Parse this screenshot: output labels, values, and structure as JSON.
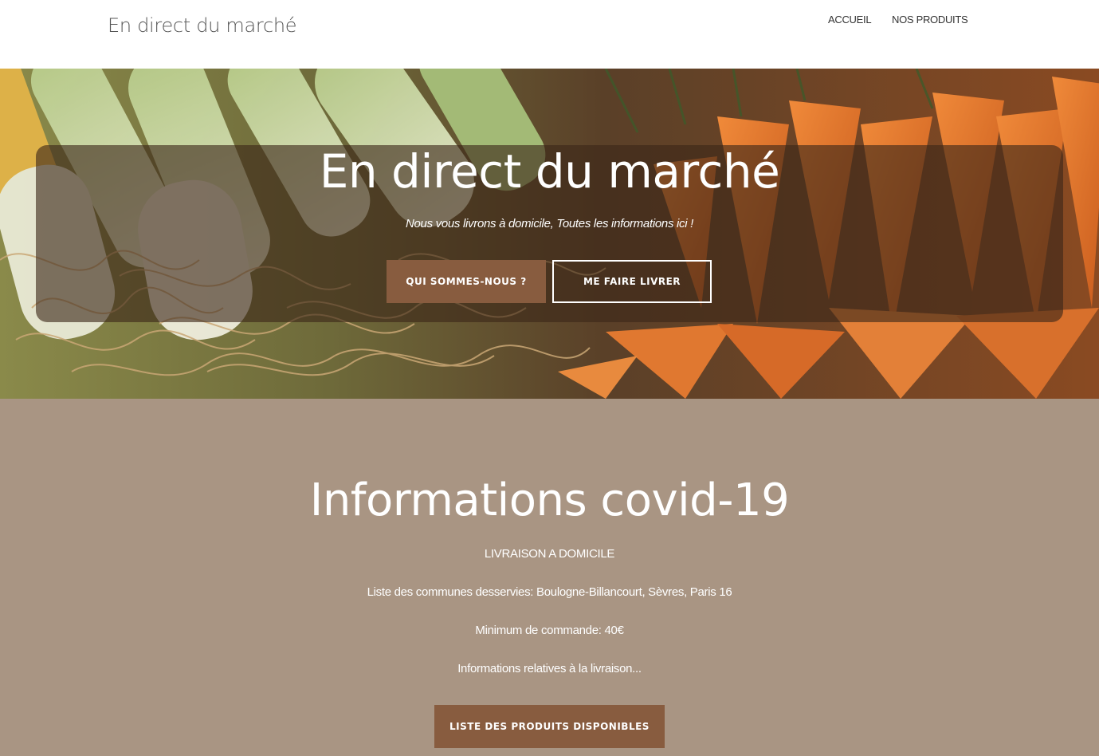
{
  "header": {
    "site_title": "En direct du marché",
    "nav": [
      "ACCUEIL",
      "NOS PRODUITS"
    ]
  },
  "hero": {
    "title": "En direct du marché",
    "subtitle": "Nous vous livrons à domicile, Toutes les informations ici !",
    "primary_button": "QUI SOMMES-NOUS ?",
    "secondary_button": "ME FAIRE LIVRER",
    "image_subject": "leeks-and-carrots-photo"
  },
  "info": {
    "title": "Informations covid-19",
    "lines": [
      "LIVRAISON A DOMICILE",
      "Liste des communes desservies: Boulogne-Billancourt, Sèvres, Paris 16",
      "Minimum de commande: 40€",
      "Informations relatives à la livraison..."
    ],
    "button": "LISTE DES PRODUITS DISPONIBLES"
  },
  "colors": {
    "accent_brown": "#885c3f",
    "info_background": "#a99583",
    "header_background": "#ffffff"
  }
}
